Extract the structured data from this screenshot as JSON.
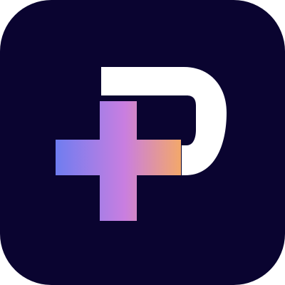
{
  "icon": {
    "name": "app-logo-icon",
    "background_color": "#0a0430",
    "letter_color": "#ffffff",
    "cross_gradient": [
      "#6f7df0",
      "#c97ee0",
      "#f3a86a"
    ]
  }
}
